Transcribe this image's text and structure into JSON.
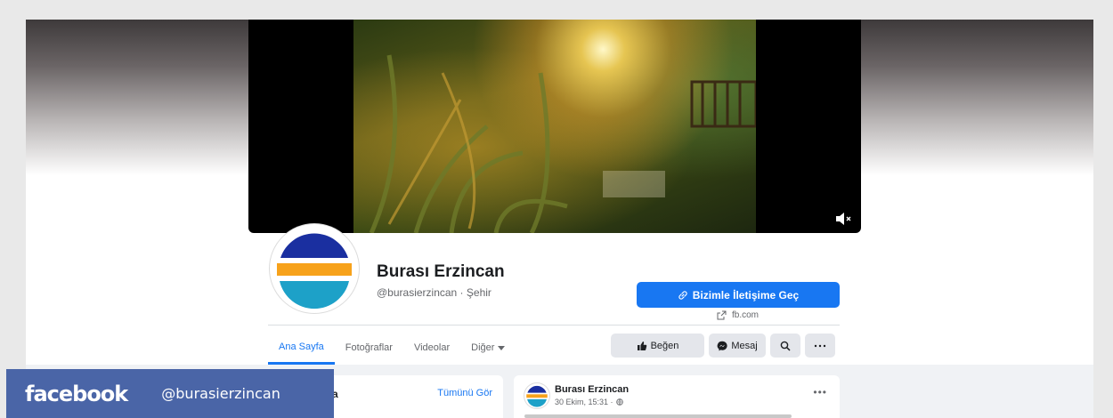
{
  "page": {
    "name": "Burası Erzincan",
    "handle": "@burasierzincan · Şehir"
  },
  "cta": {
    "contact_label": "Bizimle İletişime Geç",
    "link_text": "fb.com"
  },
  "tabs": [
    {
      "label": "Ana Sayfa",
      "active": true
    },
    {
      "label": "Fotoğraflar",
      "active": false
    },
    {
      "label": "Videolar",
      "active": false
    },
    {
      "label": "Diğer",
      "active": false
    }
  ],
  "actions": {
    "like_label": "Beğen",
    "message_label": "Mesaj"
  },
  "left_card": {
    "partial_title": "a",
    "see_all": "Tümünü Gör"
  },
  "post": {
    "author": "Burası Erzincan",
    "time": "30 Ekim, 15:31 ·"
  },
  "watermark": {
    "logo": "facebook",
    "handle": "@burasierzincan"
  },
  "colors": {
    "accent": "#1877f2",
    "watermark_bg": "#4a65a7",
    "logo_blue": "#1a2fa0",
    "logo_orange": "#f7a21b",
    "logo_cyan": "#1da1c8"
  },
  "icons": {
    "mute": "speaker-muted-icon",
    "link": "link-icon",
    "external": "external-link-icon",
    "like": "thumbs-up-icon",
    "messenger": "messenger-icon",
    "search": "search-icon",
    "more": "more-icon",
    "globe": "globe-icon"
  }
}
